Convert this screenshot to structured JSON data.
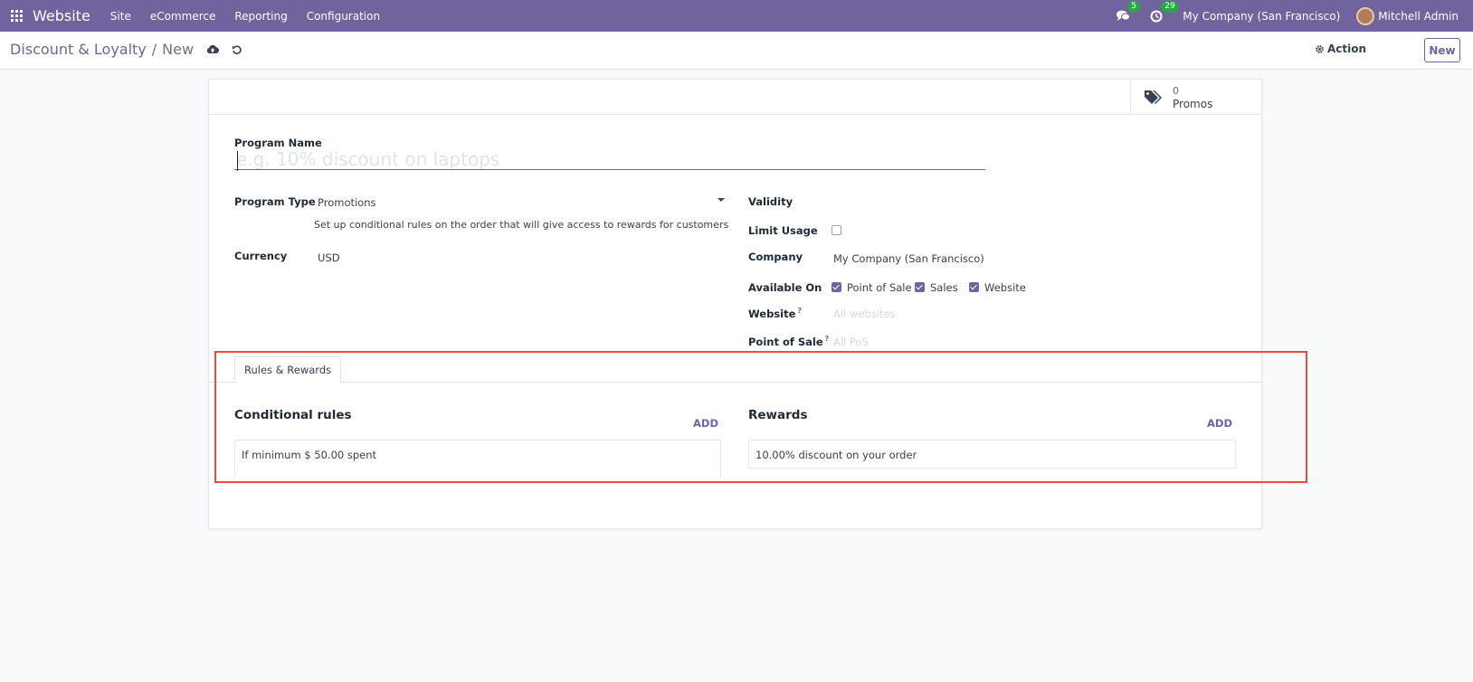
{
  "topnav": {
    "app_title": "Website",
    "menus": [
      "Site",
      "eCommerce",
      "Reporting",
      "Configuration"
    ],
    "messages_count": "5",
    "activities_count": "29",
    "company": "My Company (San Francisco)",
    "user": "Mitchell Admin"
  },
  "breadcrumb": {
    "parent": "Discount & Loyalty",
    "separator": "/",
    "current": "New"
  },
  "controls": {
    "action_label": "Action",
    "new_label": "New"
  },
  "stat_button": {
    "value": "0",
    "label": "Promos"
  },
  "form": {
    "program_name_label": "Program Name",
    "program_name_placeholder": "e.g. 10% discount on laptops",
    "program_type_label": "Program Type",
    "program_type_value": "Promotions",
    "program_type_help": "Set up conditional rules on the order that will give access to rewards for customers",
    "currency_label": "Currency",
    "currency_value": "USD",
    "validity_label": "Validity",
    "limit_usage_label": "Limit Usage",
    "limit_usage_checked": false,
    "company_label": "Company",
    "company_value": "My Company (San Francisco)",
    "available_on_label": "Available On",
    "available_on": [
      {
        "label": "Point of Sale",
        "checked": true
      },
      {
        "label": "Sales",
        "checked": true
      },
      {
        "label": "Website",
        "checked": true
      }
    ],
    "website_label": "Website",
    "website_placeholder": "All websites",
    "pos_label": "Point of Sale",
    "pos_placeholder": "All PoS",
    "help_mark": "?"
  },
  "tabs": {
    "active": "Rules & Rewards"
  },
  "rules": {
    "title": "Conditional rules",
    "add_label": "ADD",
    "items": [
      "If minimum $ 50.00 spent"
    ]
  },
  "rewards": {
    "title": "Rewards",
    "add_label": "ADD",
    "items": [
      "10.00% discount on your order"
    ]
  },
  "colors": {
    "brand": "#71639e",
    "highlight": "#e74c3c",
    "badge": "#28a745"
  }
}
